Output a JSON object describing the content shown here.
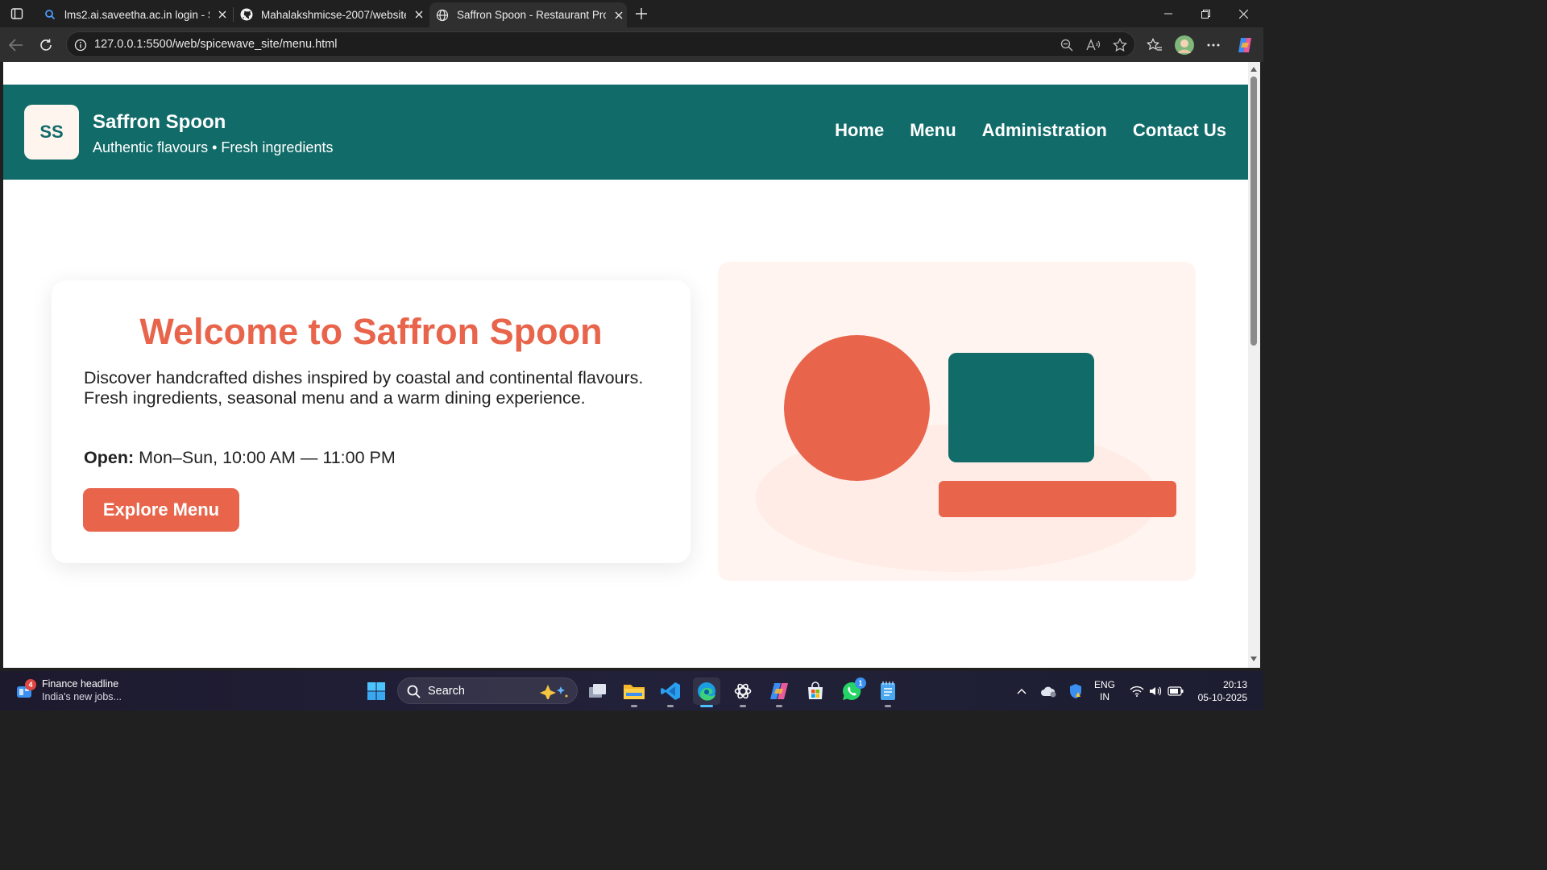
{
  "browser": {
    "tabs": [
      {
        "title": "lms2.ai.saveetha.ac.in login - Sear",
        "icon": "search-icon"
      },
      {
        "title": "Mahalakshmicse-2007/website",
        "icon": "github-icon"
      },
      {
        "title": "Saffron Spoon - Restaurant Projec",
        "icon": "globe-icon"
      }
    ],
    "url": "127.0.0.1:5500/web/spicewave_site/menu.html"
  },
  "site": {
    "logo_text": "SS",
    "name": "Saffron Spoon",
    "tagline": "Authentic flavours • Fresh ingredients",
    "nav": [
      "Home",
      "Menu",
      "Administration",
      "Contact Us"
    ],
    "hero": {
      "title": "Welcome to Saffron Spoon",
      "description": "Discover handcrafted dishes inspired by coastal and continental flavours. Fresh ingredients, seasonal menu and a warm dining experience.",
      "hours_label": "Open:",
      "hours_value": "Mon–Sun, 10:00 AM — 11:00 PM",
      "cta": "Explore Menu"
    },
    "colors": {
      "teal": "#116b69",
      "coral": "#e8644b",
      "cream": "#fff4f0"
    }
  },
  "taskbar": {
    "widget_title": "Finance headline",
    "widget_sub": "India's new jobs...",
    "widget_badge": "4",
    "search_label": "Search",
    "whatsapp_badge": "1",
    "lang_top": "ENG",
    "lang_bottom": "IN",
    "time": "20:13",
    "date": "05-10-2025"
  }
}
